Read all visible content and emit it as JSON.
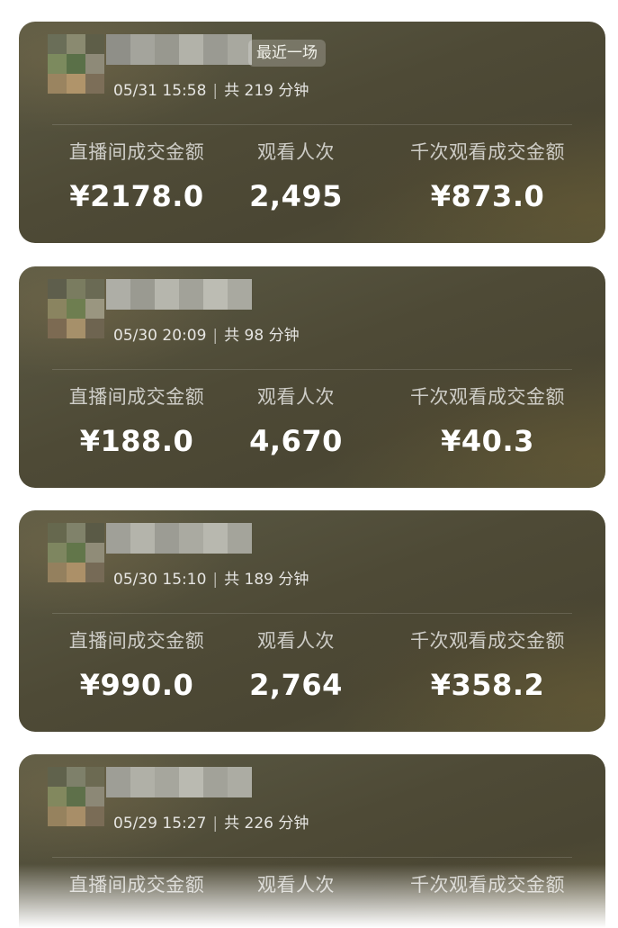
{
  "sessions": [
    {
      "tag": "最近一场",
      "date": "05/31 15:58",
      "separator": "|",
      "duration": "共 219 分钟",
      "stats": {
        "gmv_label": "直播间成交金额",
        "gmv_value": "¥2178.0",
        "views_label": "观看人次",
        "views_value": "2,495",
        "gpm_label": "千次观看成交金额",
        "gpm_value": "¥873.0"
      }
    },
    {
      "date": "05/30 20:09",
      "separator": "|",
      "duration": "共 98 分钟",
      "stats": {
        "gmv_label": "直播间成交金额",
        "gmv_value": "¥188.0",
        "views_label": "观看人次",
        "views_value": "4,670",
        "gpm_label": "千次观看成交金额",
        "gpm_value": "¥40.3"
      }
    },
    {
      "date": "05/30 15:10",
      "separator": "|",
      "duration": "共 189 分钟",
      "stats": {
        "gmv_label": "直播间成交金额",
        "gmv_value": "¥990.0",
        "views_label": "观看人次",
        "views_value": "2,764",
        "gpm_label": "千次观看成交金额",
        "gpm_value": "¥358.2"
      }
    },
    {
      "date": "05/29 15:27",
      "separator": "|",
      "duration": "共 226 分钟",
      "stats": {
        "gmv_label": "直播间成交金额",
        "views_label": "观看人次",
        "gpm_label": "千次观看成交金额"
      }
    }
  ],
  "colors": {
    "card_base": "#4e4a36",
    "text_primary": "#ffffff",
    "page_background": "#ffffff"
  }
}
